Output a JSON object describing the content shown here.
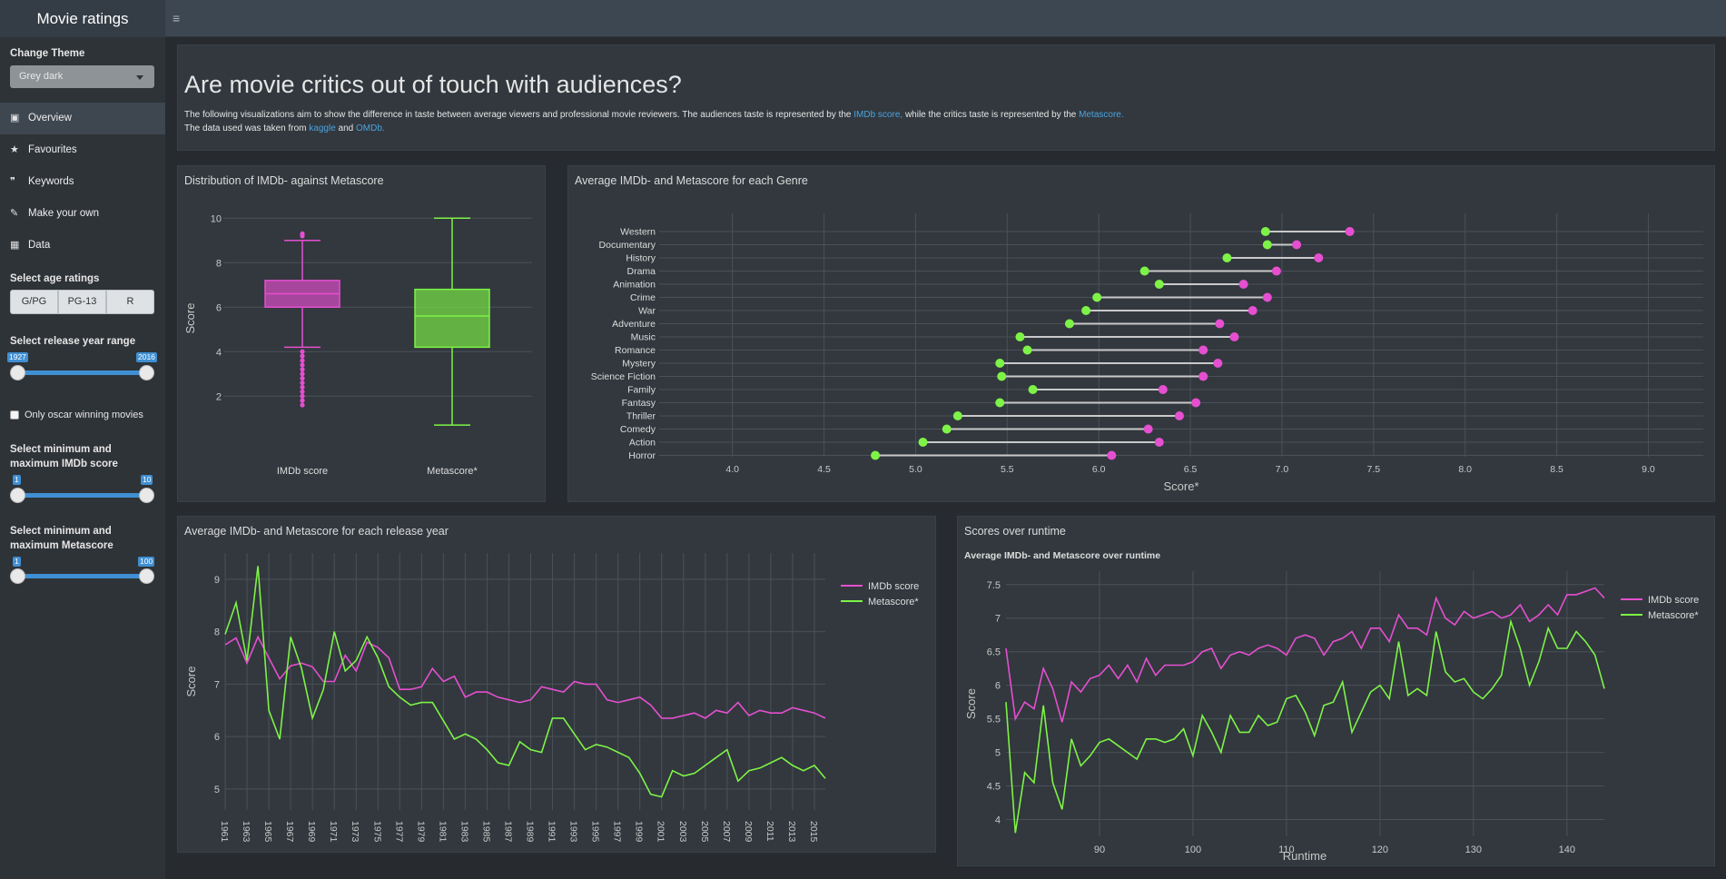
{
  "app": {
    "title": "Movie ratings",
    "menu_toggle": "≡"
  },
  "sidebar": {
    "theme_label": "Change Theme",
    "theme_value": "Grey dark",
    "menu": [
      {
        "label": "Overview",
        "icon": "id-card-icon",
        "glyph": "▣",
        "active": true
      },
      {
        "label": "Favourites",
        "icon": "star-icon",
        "glyph": "★",
        "active": false
      },
      {
        "label": "Keywords",
        "icon": "quote-icon",
        "glyph": "❞",
        "active": false
      },
      {
        "label": "Make your own",
        "icon": "edit-icon",
        "glyph": "✎",
        "active": false
      },
      {
        "label": "Data",
        "icon": "table-icon",
        "glyph": "▦",
        "active": false
      }
    ],
    "age_label": "Select age ratings",
    "age_buttons": [
      "G/PG",
      "PG-13",
      "R"
    ],
    "year_label": "Select release year range",
    "year_min": "1927",
    "year_max": "2016",
    "oscar_label": "Only oscar winning movies",
    "imdb_label_1": "Select minimum and",
    "imdb_label_2": "maximum IMDb score",
    "imdb_min": "1",
    "imdb_max": "10",
    "meta_label_1": "Select minimum and",
    "meta_label_2": "maximum Metascore",
    "meta_min": "1",
    "meta_max": "100"
  },
  "intro": {
    "heading": "Are movie critics out of touch with audiences?",
    "line1_a": "The following visualizations aim to show the difference in taste between average viewers and professional movie reviewers. The audiences taste is represented by the ",
    "line1_link1": "IMDb score,",
    "line1_b": " while the critics taste is represented by the ",
    "line1_link2": "Metascore.",
    "line2_a": "The data used was taken from ",
    "line2_link1": "kaggle",
    "line2_b": " and ",
    "line2_link2": "OMDb."
  },
  "colors": {
    "imdb": "#e54fd0",
    "meta": "#7ef347",
    "grid": "#4a5158",
    "axis_text": "#c8c8c8"
  },
  "chart_data": [
    {
      "type": "box",
      "title": "Distribution of IMDb- against Metascore",
      "ylabel": "Score",
      "ylim": [
        0.5,
        10.5
      ],
      "yticks": [
        2,
        4,
        6,
        8,
        10
      ],
      "boxes": [
        {
          "name": "IMDb score",
          "min": 4.2,
          "q1": 6.0,
          "median": 6.6,
          "q3": 7.2,
          "max": 9.0,
          "outliers": [
            9.3,
            9.2,
            4.0,
            3.8,
            3.6,
            3.4,
            3.2,
            3.0,
            2.8,
            2.6,
            2.4,
            2.2,
            2.0,
            1.8,
            1.6
          ]
        },
        {
          "name": "Metascore*",
          "min": 0.7,
          "q1": 4.2,
          "median": 5.6,
          "q3": 6.8,
          "max": 10.0,
          "outliers": []
        }
      ]
    },
    {
      "type": "dumbbell",
      "title": "Average IMDb- and Metascore for each Genre",
      "xlabel": "Score*",
      "xlim": [
        3.6,
        9.3
      ],
      "xticks": [
        4.0,
        4.5,
        5.0,
        5.5,
        6.0,
        6.5,
        7.0,
        7.5,
        8.0,
        8.5,
        9.0
      ],
      "genres": [
        "Western",
        "Documentary",
        "History",
        "Drama",
        "Animation",
        "Crime",
        "War",
        "Adventure",
        "Music",
        "Romance",
        "Mystery",
        "Science Fiction",
        "Family",
        "Fantasy",
        "Thriller",
        "Comedy",
        "Action",
        "Horror"
      ],
      "series": [
        {
          "name": "Metascore*",
          "values": [
            6.91,
            6.92,
            6.7,
            6.25,
            6.33,
            5.99,
            5.93,
            5.84,
            5.57,
            5.61,
            5.46,
            5.47,
            5.64,
            5.46,
            5.23,
            5.17,
            5.04,
            4.78
          ]
        },
        {
          "name": "IMDb score",
          "values": [
            7.37,
            7.08,
            7.2,
            6.97,
            6.79,
            6.92,
            6.84,
            6.66,
            6.74,
            6.57,
            6.65,
            6.57,
            6.35,
            6.53,
            6.44,
            6.27,
            6.33,
            6.07
          ]
        }
      ]
    },
    {
      "type": "line",
      "title": "Average IMDb- and Metascore for each release year",
      "ylabel": "Score",
      "ylim": [
        4.6,
        9.5
      ],
      "yticks": [
        5,
        6,
        7,
        8,
        9
      ],
      "x": [
        1961,
        1962,
        1963,
        1964,
        1965,
        1966,
        1967,
        1968,
        1969,
        1970,
        1971,
        1972,
        1973,
        1974,
        1975,
        1976,
        1977,
        1978,
        1979,
        1980,
        1981,
        1982,
        1983,
        1984,
        1985,
        1986,
        1987,
        1988,
        1989,
        1990,
        1991,
        1992,
        1993,
        1994,
        1995,
        1996,
        1997,
        1998,
        1999,
        2000,
        2001,
        2002,
        2003,
        2004,
        2005,
        2006,
        2007,
        2008,
        2009,
        2010,
        2011,
        2012,
        2013,
        2014,
        2015,
        2016
      ],
      "xticks": [
        1961,
        1963,
        1965,
        1967,
        1969,
        1971,
        1973,
        1975,
        1977,
        1979,
        1981,
        1983,
        1985,
        1987,
        1989,
        1991,
        1993,
        1995,
        1997,
        1999,
        2001,
        2003,
        2005,
        2007,
        2009,
        2011,
        2013,
        2015
      ],
      "series": [
        {
          "name": "IMDb score",
          "values": [
            7.75,
            7.88,
            7.4,
            7.9,
            7.5,
            7.1,
            7.35,
            7.4,
            7.33,
            7.05,
            7.05,
            7.55,
            7.25,
            7.8,
            7.7,
            7.5,
            6.9,
            6.9,
            6.95,
            7.3,
            7.05,
            7.15,
            6.75,
            6.85,
            6.85,
            6.75,
            6.7,
            6.65,
            6.7,
            6.95,
            6.9,
            6.85,
            7.05,
            7.0,
            7.0,
            6.7,
            6.65,
            6.7,
            6.75,
            6.6,
            6.35,
            6.35,
            6.4,
            6.45,
            6.35,
            6.5,
            6.45,
            6.65,
            6.4,
            6.5,
            6.45,
            6.45,
            6.55,
            6.5,
            6.45,
            6.35
          ]
        },
        {
          "name": "Metascore*",
          "values": [
            7.95,
            8.55,
            7.45,
            9.25,
            6.5,
            5.95,
            7.9,
            7.3,
            6.35,
            6.9,
            8.0,
            7.25,
            7.45,
            7.9,
            7.5,
            6.95,
            6.75,
            6.6,
            6.65,
            6.65,
            6.3,
            5.95,
            6.05,
            5.95,
            5.75,
            5.5,
            5.45,
            5.9,
            5.75,
            5.7,
            6.35,
            6.35,
            6.05,
            5.75,
            5.85,
            5.8,
            5.7,
            5.6,
            5.3,
            4.9,
            4.85,
            5.35,
            5.25,
            5.3,
            5.45,
            5.6,
            5.75,
            5.15,
            5.35,
            5.4,
            5.5,
            5.6,
            5.45,
            5.35,
            5.45,
            5.2
          ]
        }
      ]
    },
    {
      "type": "line",
      "title": "Scores over runtime",
      "subtitle": "Average IMDb- and Metascore over runtime",
      "xlabel": "Runtime",
      "ylabel": "Score",
      "xlim": [
        80,
        144
      ],
      "ylim": [
        3.75,
        7.7
      ],
      "xticks": [
        90,
        100,
        110,
        120,
        130,
        140
      ],
      "yticks": [
        4,
        4.5,
        5,
        5.5,
        6,
        6.5,
        7,
        7.5
      ],
      "x": [
        80,
        81,
        82,
        83,
        84,
        85,
        86,
        87,
        88,
        89,
        90,
        91,
        92,
        93,
        94,
        95,
        96,
        97,
        98,
        99,
        100,
        101,
        102,
        103,
        104,
        105,
        106,
        107,
        108,
        109,
        110,
        111,
        112,
        113,
        114,
        115,
        116,
        117,
        118,
        119,
        120,
        121,
        122,
        123,
        124,
        125,
        126,
        127,
        128,
        129,
        130,
        131,
        132,
        133,
        134,
        135,
        136,
        137,
        138,
        139,
        140,
        141,
        142,
        143,
        144
      ],
      "series": [
        {
          "name": "IMDb score",
          "values": [
            6.55,
            5.5,
            5.75,
            5.65,
            6.25,
            5.95,
            5.45,
            6.05,
            5.9,
            6.1,
            6.15,
            6.3,
            6.1,
            6.3,
            6.05,
            6.4,
            6.15,
            6.3,
            6.3,
            6.3,
            6.35,
            6.5,
            6.55,
            6.25,
            6.45,
            6.5,
            6.45,
            6.55,
            6.6,
            6.55,
            6.45,
            6.7,
            6.75,
            6.7,
            6.45,
            6.65,
            6.7,
            6.8,
            6.55,
            6.85,
            6.85,
            6.65,
            7.05,
            6.85,
            6.85,
            6.75,
            7.3,
            7.0,
            6.9,
            7.1,
            7.0,
            7.05,
            7.1,
            7.0,
            7.05,
            7.2,
            6.95,
            7.05,
            7.2,
            7.05,
            7.35,
            7.35,
            7.4,
            7.45,
            7.3
          ]
        },
        {
          "name": "Metascore*",
          "values": [
            5.75,
            3.8,
            4.7,
            4.55,
            5.7,
            4.55,
            4.15,
            5.2,
            4.8,
            4.95,
            5.15,
            5.2,
            5.1,
            5.0,
            4.9,
            5.2,
            5.2,
            5.15,
            5.2,
            5.35,
            4.95,
            5.55,
            5.3,
            5.0,
            5.55,
            5.3,
            5.3,
            5.55,
            5.4,
            5.45,
            5.8,
            5.85,
            5.6,
            5.25,
            5.7,
            5.75,
            6.05,
            5.3,
            5.6,
            5.9,
            6.0,
            5.8,
            6.65,
            5.85,
            5.95,
            5.85,
            6.8,
            6.2,
            6.05,
            6.1,
            5.9,
            5.8,
            5.95,
            6.15,
            6.95,
            6.55,
            6.0,
            6.35,
            6.85,
            6.55,
            6.55,
            6.8,
            6.65,
            6.45,
            5.95
          ]
        }
      ]
    }
  ]
}
